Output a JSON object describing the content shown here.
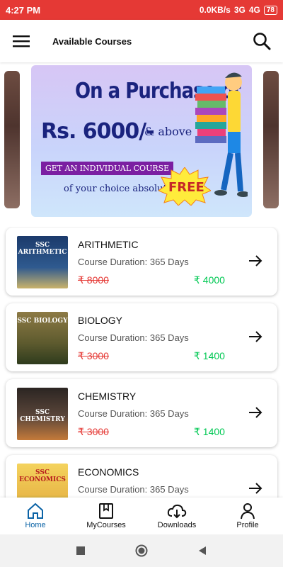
{
  "status_bar": {
    "time": "4:27 PM",
    "speed": "0.0KB/s",
    "network1": "3G",
    "network2": "4G",
    "battery": "78"
  },
  "app_bar": {
    "title": "Available Courses",
    "menu_icon": "hamburger-menu-icon",
    "search_icon": "search-icon"
  },
  "banner": {
    "line1": "On a Purchase of",
    "line2": "Rs. 6000/-",
    "line2b": "& above",
    "line3": "GET AN INDIVIDUAL COURSE",
    "line4": "of your choice absolutely",
    "free": "FREE"
  },
  "courses": [
    {
      "thumb_label": "SSC ARITHMETIC",
      "name": "ARITHMETIC",
      "duration": "Course Duration: 365 Days",
      "old_price": "₹ 8000",
      "new_price": "₹ 4000",
      "thumb_color": "#1b3a6b"
    },
    {
      "thumb_label": "SSC BIOLOGY",
      "name": "BIOLOGY",
      "duration": "Course Duration: 365 Days",
      "old_price": "₹ 3000",
      "new_price": "₹ 1400",
      "thumb_color": "#7a6a3a"
    },
    {
      "thumb_label": "SSC CHEMISTRY",
      "name": "CHEMISTRY",
      "duration": "Course Duration: 365 Days",
      "old_price": "₹ 3000",
      "new_price": "₹ 1400",
      "thumb_color": "#3e2f2a"
    },
    {
      "thumb_label": "SSC ECONOMICS",
      "name": "ECONOMICS",
      "duration": "Course Duration: 365 Days",
      "old_price": "",
      "new_price": "",
      "thumb_color": "#e8c64a"
    }
  ],
  "bottom_nav": {
    "home": "Home",
    "mycourses": "MyCourses",
    "downloads": "Downloads",
    "profile": "Profile"
  },
  "colors": {
    "status_bar": "#e53935",
    "old_price": "#e53935",
    "new_price": "#00c853",
    "active_nav": "#0b63a6"
  }
}
